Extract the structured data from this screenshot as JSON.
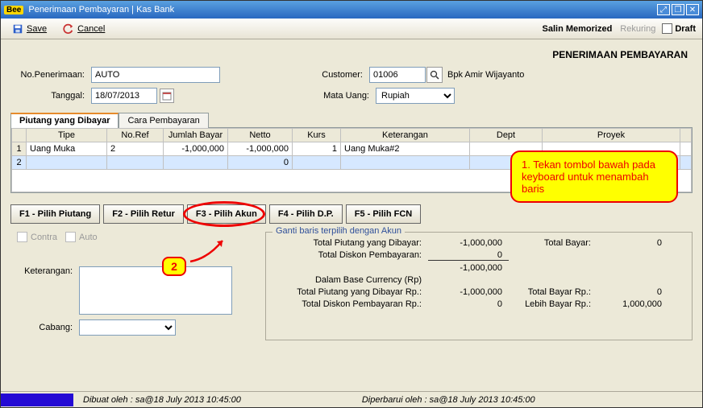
{
  "window": {
    "title": "Penerimaan Pembayaran | Kas Bank"
  },
  "toolbar": {
    "save": "Save",
    "cancel": "Cancel",
    "salin": "Salin Memorized",
    "rekuring": "Rekuring",
    "draft": "Draft"
  },
  "heading": "PENERIMAAN PEMBAYARAN",
  "form": {
    "no_pen_lbl": "No.Penerimaan:",
    "no_pen": "AUTO",
    "tanggal_lbl": "Tanggal:",
    "tanggal": "18/07/2013",
    "customer_lbl": "Customer:",
    "customer": "01006",
    "customer_name": "Bpk Amir Wijayanto",
    "matauang_lbl": "Mata Uang:",
    "matauang": "Rupiah"
  },
  "tabs": {
    "t1": "Piutang yang Dibayar",
    "t2": "Cara Pembayaran"
  },
  "grid": {
    "cols": [
      "Tipe",
      "No.Ref",
      "Jumlah Bayar",
      "Netto",
      "Kurs",
      "Keterangan",
      "Dept",
      "Proyek"
    ],
    "rows": [
      {
        "n": "1",
        "tipe": "Uang Muka",
        "noref": "2",
        "jumlah": "-1,000,000",
        "netto": "-1,000,000",
        "kurs": "1",
        "ket": "Uang Muka#2",
        "dept": "",
        "proyek": ""
      },
      {
        "n": "2",
        "tipe": "",
        "noref": "",
        "jumlah": "",
        "netto": "0",
        "kurs": "",
        "ket": "",
        "dept": "",
        "proyek": ""
      }
    ]
  },
  "buttons": {
    "f1": "F1 - Pilih Piutang",
    "f2": "F2 - Pilih Retur",
    "f3": "F3 - Pilih Akun",
    "f4": "F4 - Pilih D.P.",
    "f5": "F5 - Pilih FCN"
  },
  "checks": {
    "contra": "Contra",
    "auto": "Auto"
  },
  "keterangan_lbl": "Keterangan:",
  "cabang_lbl": "Cabang:",
  "group_lbl": "Ganti baris terpilih dengan Akun",
  "summary": {
    "r1l": "Total Piutang yang Dibayar:",
    "r1v": "-1,000,000",
    "r1l2": "Total Bayar:",
    "r1v2": "0",
    "r2l": "Total Diskon Pembayaran:",
    "r2v": "0",
    "r3v": "-1,000,000",
    "r4l": "Dalam Base Currency (Rp)",
    "r5l": "Total Piutang yang Dibayar Rp.:",
    "r5v": "-1,000,000",
    "r5l2": "Total Bayar Rp.:",
    "r5v2": "0",
    "r6l": "Total Diskon Pembayaran Rp.:",
    "r6v": "0",
    "r6l2": "Lebih Bayar Rp.:",
    "r6v2": "1,000,000"
  },
  "status": {
    "s1": "Dibuat oleh : sa@18 July 2013  10:45:00",
    "s2": "Diperbarui oleh : sa@18 July 2013  10:45:00"
  },
  "callout1": "1. Tekan tombol bawah pada keyboard untuk menambah baris",
  "callout2": "2"
}
